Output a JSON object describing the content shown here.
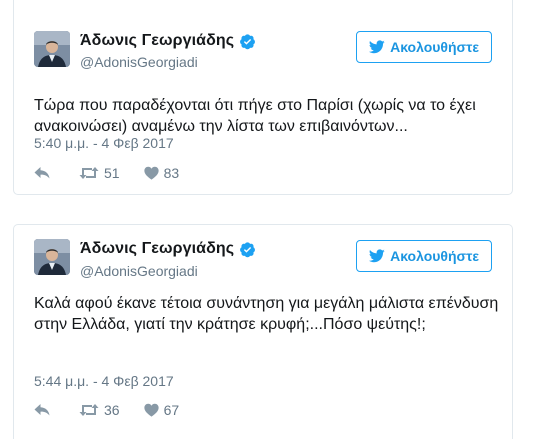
{
  "tweets": [
    {
      "name": "Άδωνις Γεωργιάδης",
      "handle": "@AdonisGeorgiadi",
      "follow_label": "Ακολουθήστε",
      "text": "Τώρα που παραδέχονται ότι πήγε στο Παρίσι (χωρίς να το έχει ανακοινώσει) αναμένω την λίστα των επιβαινόντων...",
      "time": "5:40 μ.μ. - 4 Φεβ 2017",
      "retweets": "51",
      "likes": "83"
    },
    {
      "name": "Άδωνις Γεωργιάδης",
      "handle": "@AdonisGeorgiadi",
      "follow_label": "Ακολουθήστε",
      "text": "Καλά αφού έκανε τέτοια συνάντηση για μεγάλη μάλιστα επένδυση στην Ελλάδα, γιατί την κράτησε κρυφή;...Πόσο ψεύτης!;",
      "time": "5:44 μ.μ. - 4 Φεβ 2017",
      "retweets": "36",
      "likes": "67"
    }
  ],
  "colors": {
    "accent": "#1da1f2",
    "secondary_text": "#657786",
    "icon_gray": "#8899a6",
    "border": "#e1e8ed"
  },
  "icons": [
    "verified-icon",
    "twitter-bird-icon",
    "reply-icon",
    "retweet-icon",
    "like-icon"
  ]
}
